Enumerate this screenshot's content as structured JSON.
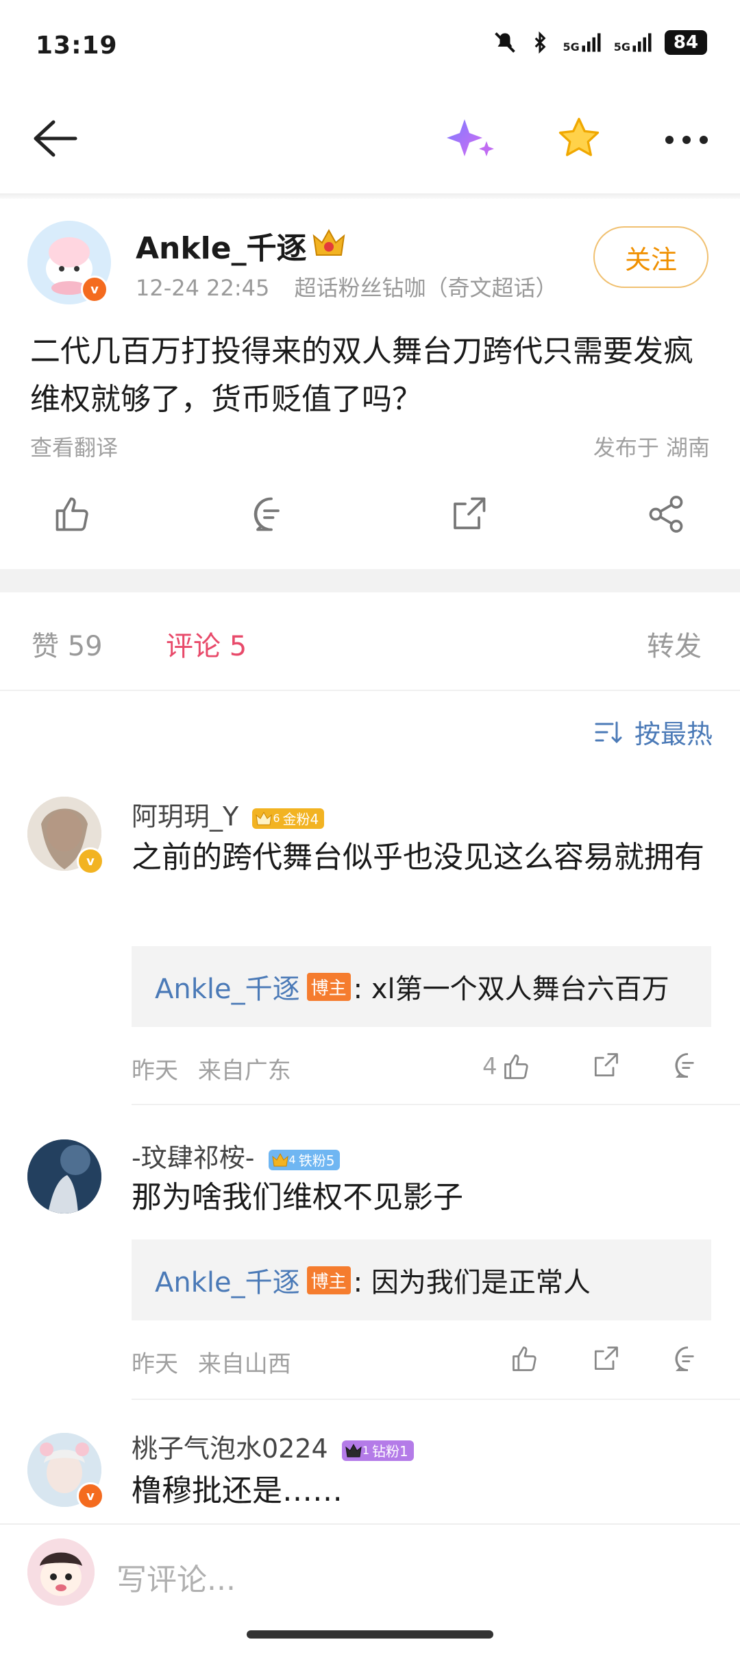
{
  "status_bar": {
    "time": "13:19",
    "battery": "84",
    "signal1": "5G",
    "signal2": "5G"
  },
  "nav": {
    "back_icon": "arrow-left-icon",
    "sparkle_icon": "sparkle-icon",
    "star_icon": "star-icon",
    "more_icon": "more-icon"
  },
  "post": {
    "author": "Ankle_千逐",
    "time": "12-24 22:45",
    "source": "超话粉丝钻咖（奇文超话）",
    "follow_label": "关注",
    "text": "二代几百万打投得来的双人舞台刀跨代只需要发疯维权就够了，货币贬值了吗？",
    "translate_label": "查看翻译",
    "location": "发布于 湖南"
  },
  "tabs": {
    "likes": "赞 59",
    "comments": "评论 5",
    "reposts": "转发"
  },
  "sort_label": "按最热",
  "comments": [
    {
      "name": "阿玥玥_Y",
      "fan_level": "6",
      "fan_badge": "金粉4",
      "text": "之前的跨代舞台似乎也没见这么容易就拥有",
      "reply_name": "Ankle_千逐",
      "reply_tag": "博主",
      "reply_text": ": xl第一个双人舞台六百万",
      "time": "昨天",
      "from": "来自广东",
      "likes": "4"
    },
    {
      "name": "-玟肆祁桉-",
      "fan_level": "4",
      "fan_badge": "铁粉5",
      "text": "那为啥我们维权不见影子",
      "reply_name": "Ankle_千逐",
      "reply_tag": "博主",
      "reply_text": ": 因为我们是正常人",
      "time": "昨天",
      "from": "来自山西",
      "likes": ""
    },
    {
      "name": "桃子气泡水0224",
      "fan_level": "1",
      "fan_badge": "钻粉1",
      "text": "橹穆批还是……"
    }
  ],
  "bottom": {
    "placeholder": "写评论..."
  },
  "colors": {
    "accent_pink": "#e84a6a",
    "link_blue": "#4b7ab7",
    "follow_orange": "#f09000",
    "host_tag": "#f57c2e"
  }
}
